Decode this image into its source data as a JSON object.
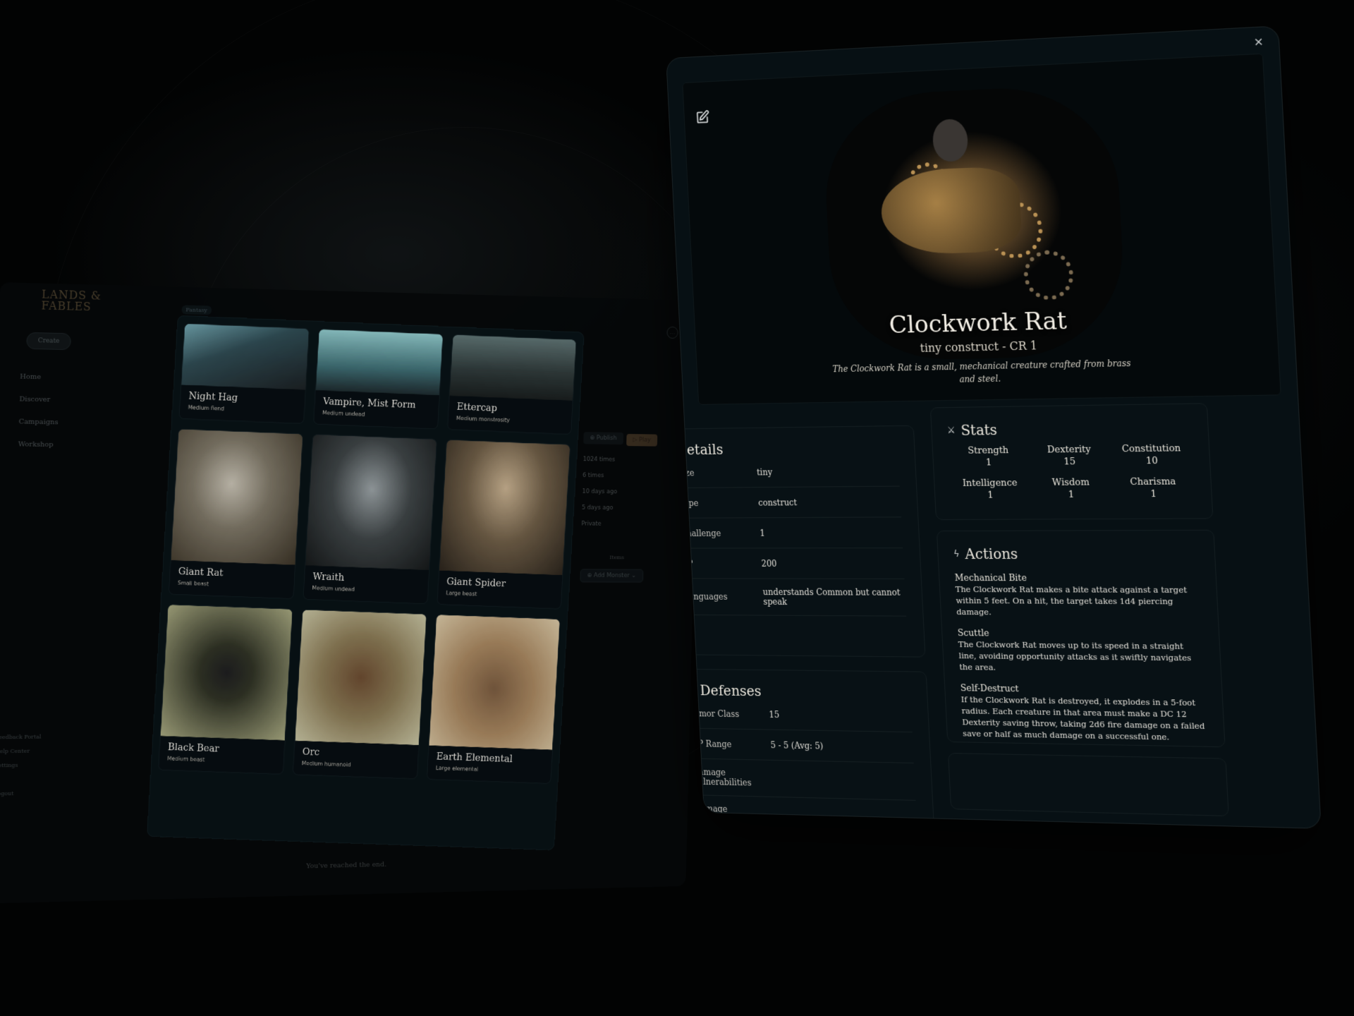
{
  "app": {
    "logo_text": "LANDS & FABLES",
    "sidebar": {
      "create_label": "Create",
      "nav": [
        "Home",
        "Discover",
        "Campaigns",
        "Workshop"
      ],
      "bottom_links": [
        "Feedback Portal",
        "Help Center",
        "Settings",
        "Logout"
      ]
    },
    "filter_tag": "Fantasy",
    "end_of_list": "You've reached the end.",
    "monsters": [
      {
        "name": "Night Hag",
        "subtitle": "Medium fiend"
      },
      {
        "name": "Vampire, Mist Form",
        "subtitle": "Medium undead"
      },
      {
        "name": "Ettercap",
        "subtitle": "Medium monstrosity"
      },
      {
        "name": "Giant Rat",
        "subtitle": "Small beast"
      },
      {
        "name": "Wraith",
        "subtitle": "Medium undead"
      },
      {
        "name": "Giant Spider",
        "subtitle": "Large beast"
      },
      {
        "name": "Black Bear",
        "subtitle": "Medium beast"
      },
      {
        "name": "Orc",
        "subtitle": "Medium humanoid"
      },
      {
        "name": "Earth Elemental",
        "subtitle": "Large elemental"
      }
    ],
    "campaign": {
      "publish_label": "Publish",
      "play_label": "Play",
      "stats_lines": [
        "1024 times",
        "6 times",
        "10 days ago",
        "5 days ago",
        "Private"
      ],
      "items_label": "Items",
      "add_monster_label": "Add Monster",
      "more_label": "…"
    }
  },
  "monster_modal": {
    "close_label": "×",
    "name": "Clockwork Rat",
    "subtitle": "tiny construct - CR 1",
    "description": "The Clockwork Rat is a small, mechanical creature crafted from brass and steel.",
    "details": {
      "title": "Details",
      "rows": [
        {
          "key": "Size",
          "value": "tiny"
        },
        {
          "key": "Type",
          "value": "construct"
        },
        {
          "key": "Challenge",
          "value": "1"
        },
        {
          "key": "XP",
          "value": "200"
        },
        {
          "key": "Languages",
          "value": "understands Common but cannot speak"
        }
      ]
    },
    "defenses": {
      "title": "Defenses",
      "rows": [
        {
          "key": "Armor Class",
          "value": "15"
        },
        {
          "key": "HP Range",
          "value": "5 - 5 (Avg: 5)"
        },
        {
          "key": "Damage Vulnerabilities",
          "value": ""
        },
        {
          "key": "Damage Resistances",
          "value": ""
        }
      ]
    },
    "stats": {
      "title": "Stats",
      "items": [
        {
          "label": "Strength",
          "value": "1"
        },
        {
          "label": "Dexterity",
          "value": "15"
        },
        {
          "label": "Constitution",
          "value": "10"
        },
        {
          "label": "Intelligence",
          "value": "1"
        },
        {
          "label": "Wisdom",
          "value": "1"
        },
        {
          "label": "Charisma",
          "value": "1"
        }
      ]
    },
    "actions": {
      "title": "Actions",
      "items": [
        {
          "name": "Mechanical Bite",
          "text": "The Clockwork Rat makes a bite attack against a target within 5 feet. On a hit, the target takes 1d4 piercing damage."
        },
        {
          "name": "Scuttle",
          "text": "The Clockwork Rat moves up to its speed in a straight line, avoiding opportunity attacks as it swiftly navigates the area."
        },
        {
          "name": "Self-Destruct",
          "text": "If the Clockwork Rat is destroyed, it explodes in a 5-foot radius. Each creature in that area must make a DC 12 Dexterity saving throw, taking 2d6 fire damage on a failed save or half as much damage on a successful one."
        }
      ]
    }
  }
}
